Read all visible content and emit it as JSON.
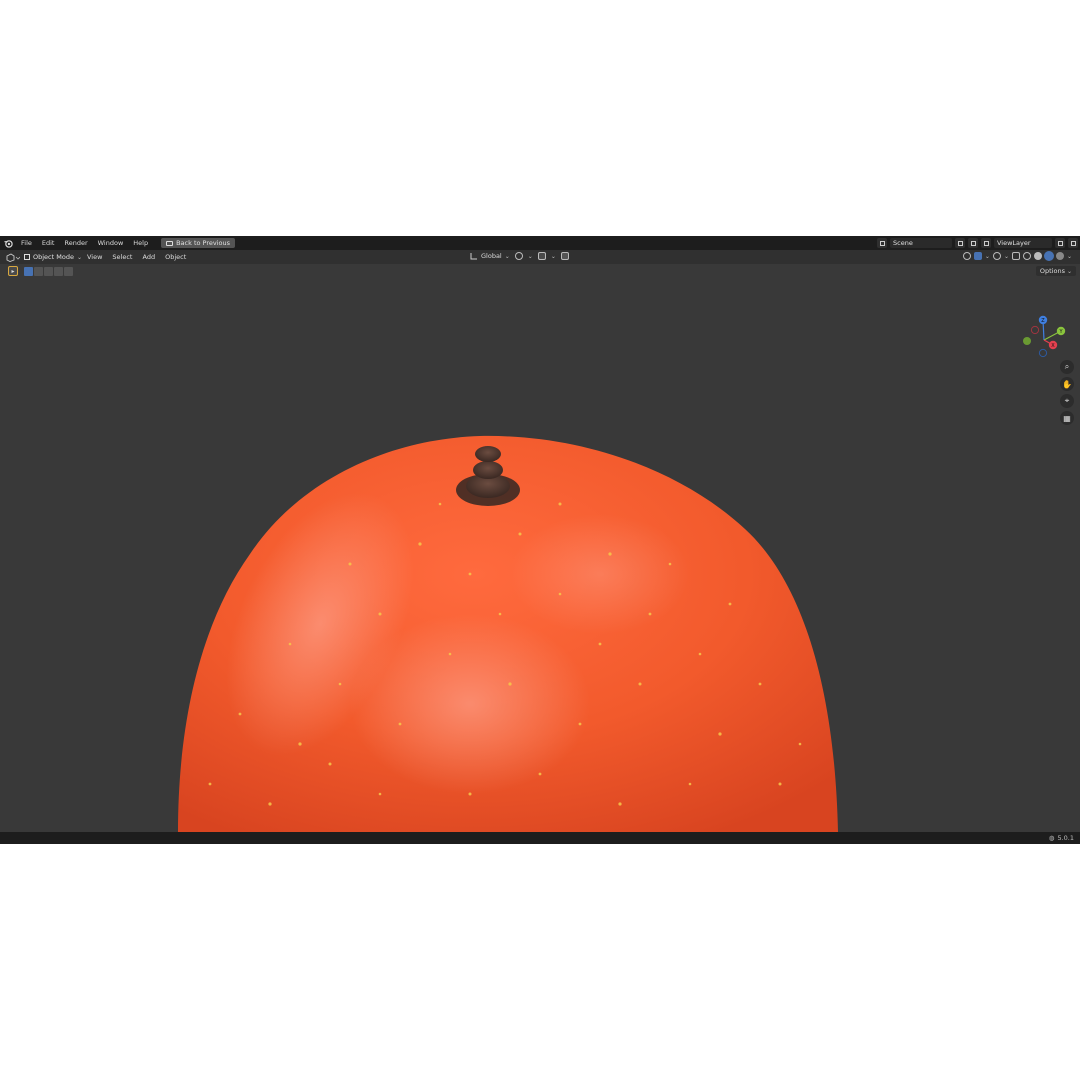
{
  "menu": {
    "items": [
      "File",
      "Edit",
      "Render",
      "Window",
      "Help"
    ],
    "back_label": "Back to Previous"
  },
  "workspace": {
    "scene_label": "Scene",
    "view_layer_label": "ViewLayer"
  },
  "header": {
    "mode_label": "Object Mode",
    "menus": [
      "View",
      "Select",
      "Add",
      "Object"
    ],
    "orientation_label": "Global"
  },
  "toolbar": {
    "options_label": "Options"
  },
  "gizmo": {
    "z_label": "Z",
    "y_label": "Y",
    "x_label": "X"
  },
  "status": {
    "version": "5.0.1"
  },
  "colors": {
    "app_bg": "#393939",
    "topbar_bg": "#1d1d1d",
    "accent_blue": "#4772b3",
    "mango_orange": "#f25c2e",
    "axis_x": "#e4404f",
    "axis_y": "#8ac43d",
    "axis_z": "#3f7fe0"
  }
}
